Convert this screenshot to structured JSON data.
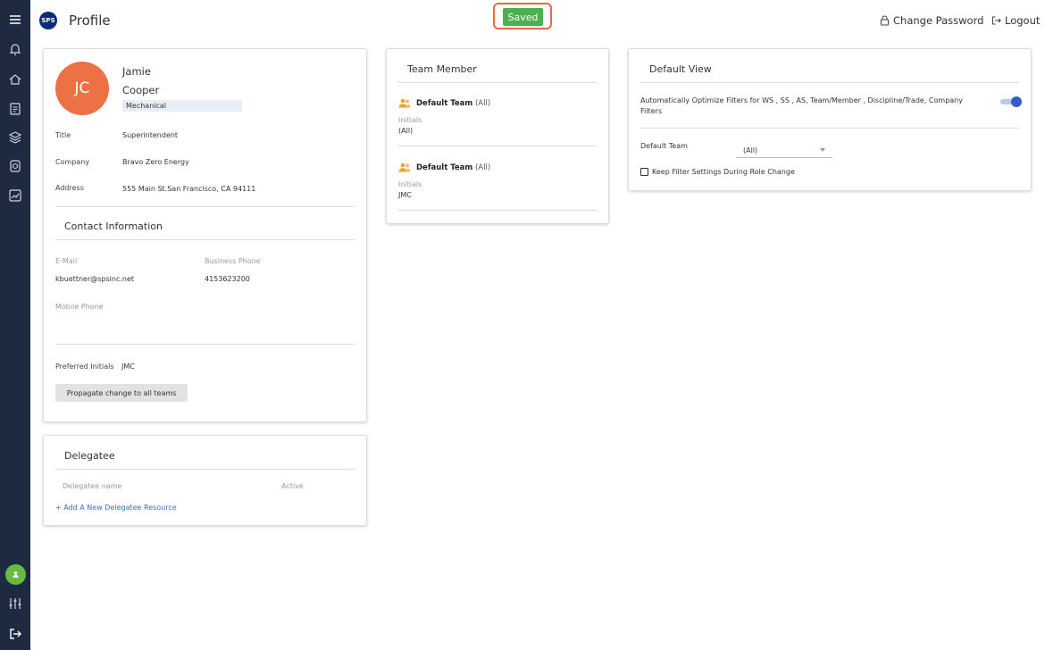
{
  "app": {
    "logo_text": "SPS",
    "page_title": "Profile",
    "saved_label": "Saved"
  },
  "header": {
    "change_password": "Change Password",
    "logout": "Logout"
  },
  "sidebar": {
    "items": [
      {
        "icon": "menu-icon"
      },
      {
        "icon": "bell-icon"
      },
      {
        "icon": "home-icon"
      },
      {
        "icon": "document-list-icon"
      },
      {
        "icon": "layers-icon"
      },
      {
        "icon": "book-icon"
      },
      {
        "icon": "chart-icon"
      },
      {
        "icon": "user-icon"
      },
      {
        "icon": "sliders-icon"
      },
      {
        "icon": "sign-out-icon"
      }
    ]
  },
  "profile": {
    "initials": "JC",
    "first_name": "Jamie",
    "last_name": "Cooper",
    "discipline": "Mechanical",
    "title_label": "Title",
    "title_value": "Superintendent",
    "company_label": "Company",
    "company_value": "Bravo Zero Energy",
    "address_label": "Address",
    "address_value": "555 Main St.San Francisco, CA 94111",
    "contact_heading": "Contact Information",
    "email_label": "E-Mail",
    "email_value": "kbuettner@spsinc.net",
    "business_phone_label": "Business Phone",
    "business_phone_value": "4153623200",
    "mobile_phone_label": "Mobile Phone",
    "preferred_initials_label": "Preferred Initials",
    "preferred_initials_value": "JMC",
    "propagate_button": "Propagate change to all teams"
  },
  "delegatee": {
    "heading": "Delegatee",
    "col_name": "Delegatee name",
    "col_active": "Active",
    "add_link": "+ Add A New Delegatee Resource"
  },
  "team_member": {
    "heading": "Team Member",
    "teams": [
      {
        "name": "Default Team",
        "scope": "(All)",
        "initials_label": "Initials",
        "initials_value": "(All)"
      },
      {
        "name": "Default Team",
        "scope": "(All)",
        "initials_label": "Initials",
        "initials_value": "JMC"
      }
    ]
  },
  "default_view": {
    "heading": "Default View",
    "auto_optimize_label": "Automatically Optimize Filters for WS , SS , AS, Team/Member , Discipline/Trade, Company Filters",
    "auto_optimize_on": true,
    "default_team_label": "Default Team",
    "default_team_value": "(All)",
    "keep_filter_label": "Keep Filter Settings During Role Change",
    "keep_filter_checked": false
  },
  "colors": {
    "sidebar": "#1d2a3f",
    "saved": "#4caf50",
    "highlight": "#e86a45",
    "avatar": "#ec7145",
    "link": "#3d6fc7",
    "toggle": "#2f5fc3"
  }
}
